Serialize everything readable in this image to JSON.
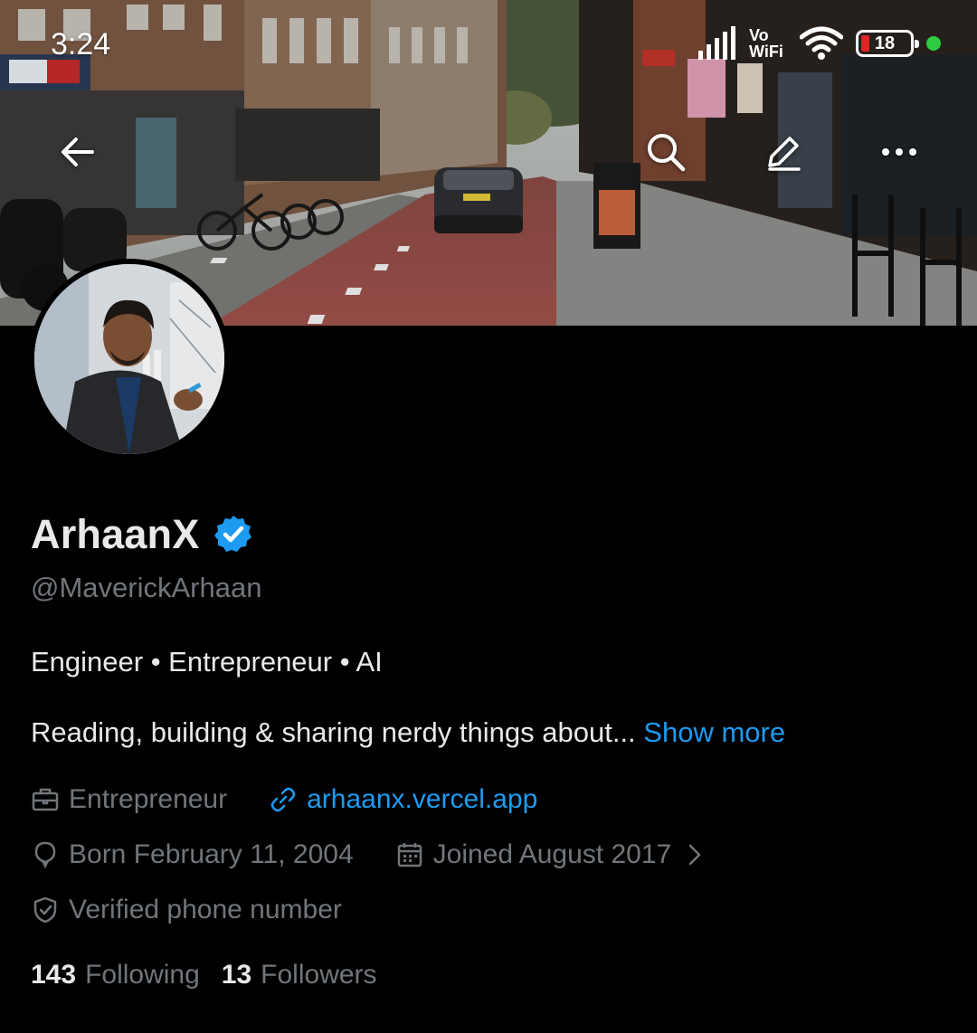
{
  "status_bar": {
    "time": "3:24",
    "network_label_top": "Vo",
    "network_label_bottom": "WiFi",
    "battery_level": "18",
    "battery_fraction": 0.18
  },
  "nav": {
    "back_icon": "arrow-left-icon",
    "search_icon": "search-icon",
    "edit_icon": "pencil-icon",
    "more_icon": "more-horizontal-icon"
  },
  "profile": {
    "display_name": "ArhaanX",
    "verified": true,
    "handle": "@MaverickArhaan",
    "bio_line1": "Engineer • Entrepreneur • AI",
    "bio_line2": "Reading, building & sharing nerdy things about...",
    "show_more": "Show more"
  },
  "meta": {
    "profession": "Entrepreneur",
    "website": "arhaanx.vercel.app",
    "birthday": "Born February 11, 2004",
    "joined": "Joined August 2017",
    "verified_phone": "Verified phone number"
  },
  "stats": {
    "following_count": "143",
    "following_label": "Following",
    "followers_count": "13",
    "followers_label": "Followers"
  },
  "colors": {
    "background": "#000000",
    "text_primary": "#e7e9ea",
    "text_secondary": "#71767b",
    "accent": "#1d9bf0",
    "battery_low": "#e02424",
    "indicator_green": "#2ecc40"
  }
}
